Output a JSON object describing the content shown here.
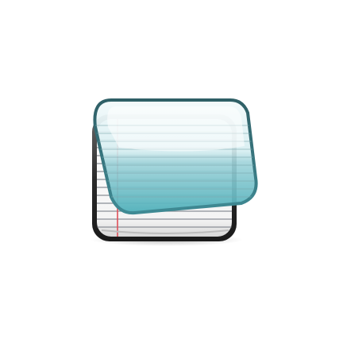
{
  "icon": {
    "name": "notepad-app-icon",
    "colors": {
      "paper": "#ffffff",
      "paper_lines": "#8a8f96",
      "margin_line": "#e0505a",
      "frame": "#2b2b2b",
      "glass_top": "#eef6f8",
      "glass_mid": "#9fd3da",
      "glass_bottom": "#4fb0ba",
      "glass_border": "#3f7f88"
    }
  }
}
